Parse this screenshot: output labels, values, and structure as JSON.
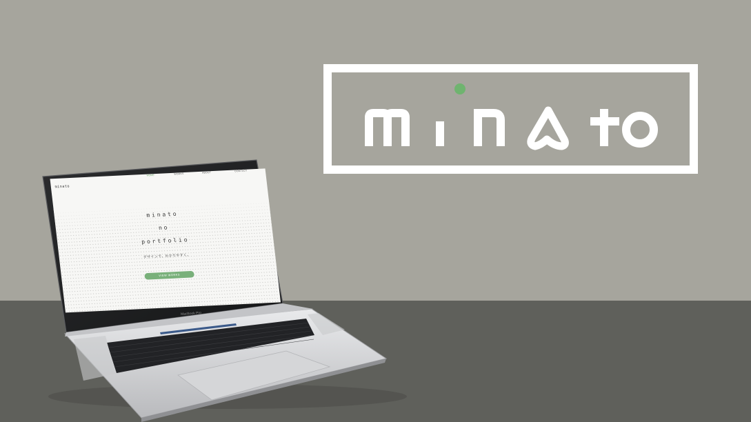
{
  "logo": {
    "text": "minato",
    "accent_color": "#6fb46f",
    "frame_color": "#ffffff"
  },
  "laptop": {
    "model_label": "MacBook Pro",
    "site": {
      "nav_logo": "minato",
      "nav": [
        "HOME",
        "WORKS",
        "ABOUT",
        "CONTACT"
      ],
      "active_nav": "HOME",
      "hero_line1": "minato",
      "hero_line2": "no",
      "hero_line3": "portfolio",
      "tagline": "デザインで、わかりやすく。",
      "cta": "VIEW WORKS",
      "accent_color": "#79b07a"
    }
  },
  "colors": {
    "wall": "#a6a59d",
    "desk": "#5f605b"
  }
}
